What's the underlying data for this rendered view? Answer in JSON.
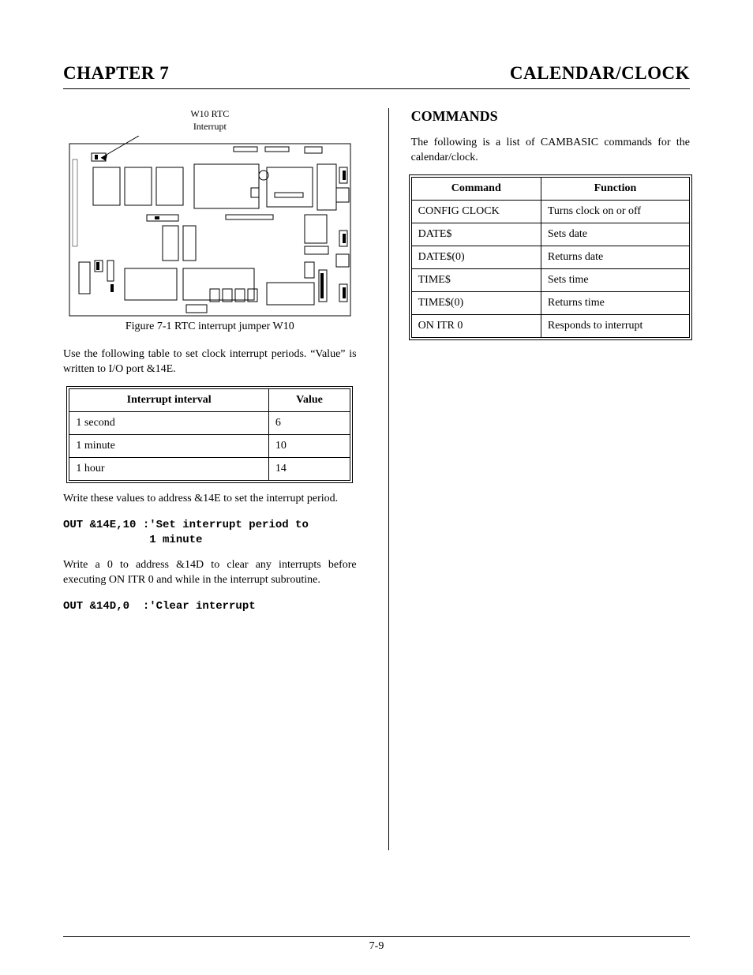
{
  "header": {
    "left": "CHAPTER 7",
    "right": "CALENDAR/CLOCK"
  },
  "figure": {
    "top_label1": "W10 RTC",
    "top_label2": "Interrupt",
    "caption": "Figure 7-1 RTC interrupt jumper W10"
  },
  "left_col": {
    "p1": "Use the following table to set clock interrupt periods. “Value” is written to I/O port &14E.",
    "table1_headers": [
      "Interrupt interval",
      "Value"
    ],
    "table1_rows": [
      [
        "1 second",
        "6"
      ],
      [
        "1 minute",
        "10"
      ],
      [
        "1 hour",
        "14"
      ]
    ],
    "p2": "Write these values to address &14E to set the interrupt period.",
    "code1_l1": "OUT &14E,10 :'Set interrupt period to",
    "code1_l2": "             1 minute",
    "p3": " Write a 0 to address &14D to clear any interrupts before executing ON ITR 0 and while in the interrupt subroutine.",
    "code2": "OUT &14D,0  :'Clear interrupt"
  },
  "right_col": {
    "section_title": "COMMANDS",
    "intro": "The following is a list of CAMBASIC commands for the calendar/clock.",
    "table_headers": [
      "Command",
      "Function"
    ],
    "table_rows": [
      [
        "CONFIG CLOCK",
        "Turns clock on or off"
      ],
      [
        "DATE$",
        "Sets date"
      ],
      [
        "DATE$(0)",
        "Returns date"
      ],
      [
        "TIME$",
        "Sets time"
      ],
      [
        "TIME$(0)",
        "Returns time"
      ],
      [
        "ON ITR 0",
        "Responds to interrupt"
      ]
    ]
  },
  "footer": {
    "page_num": "7-9"
  }
}
